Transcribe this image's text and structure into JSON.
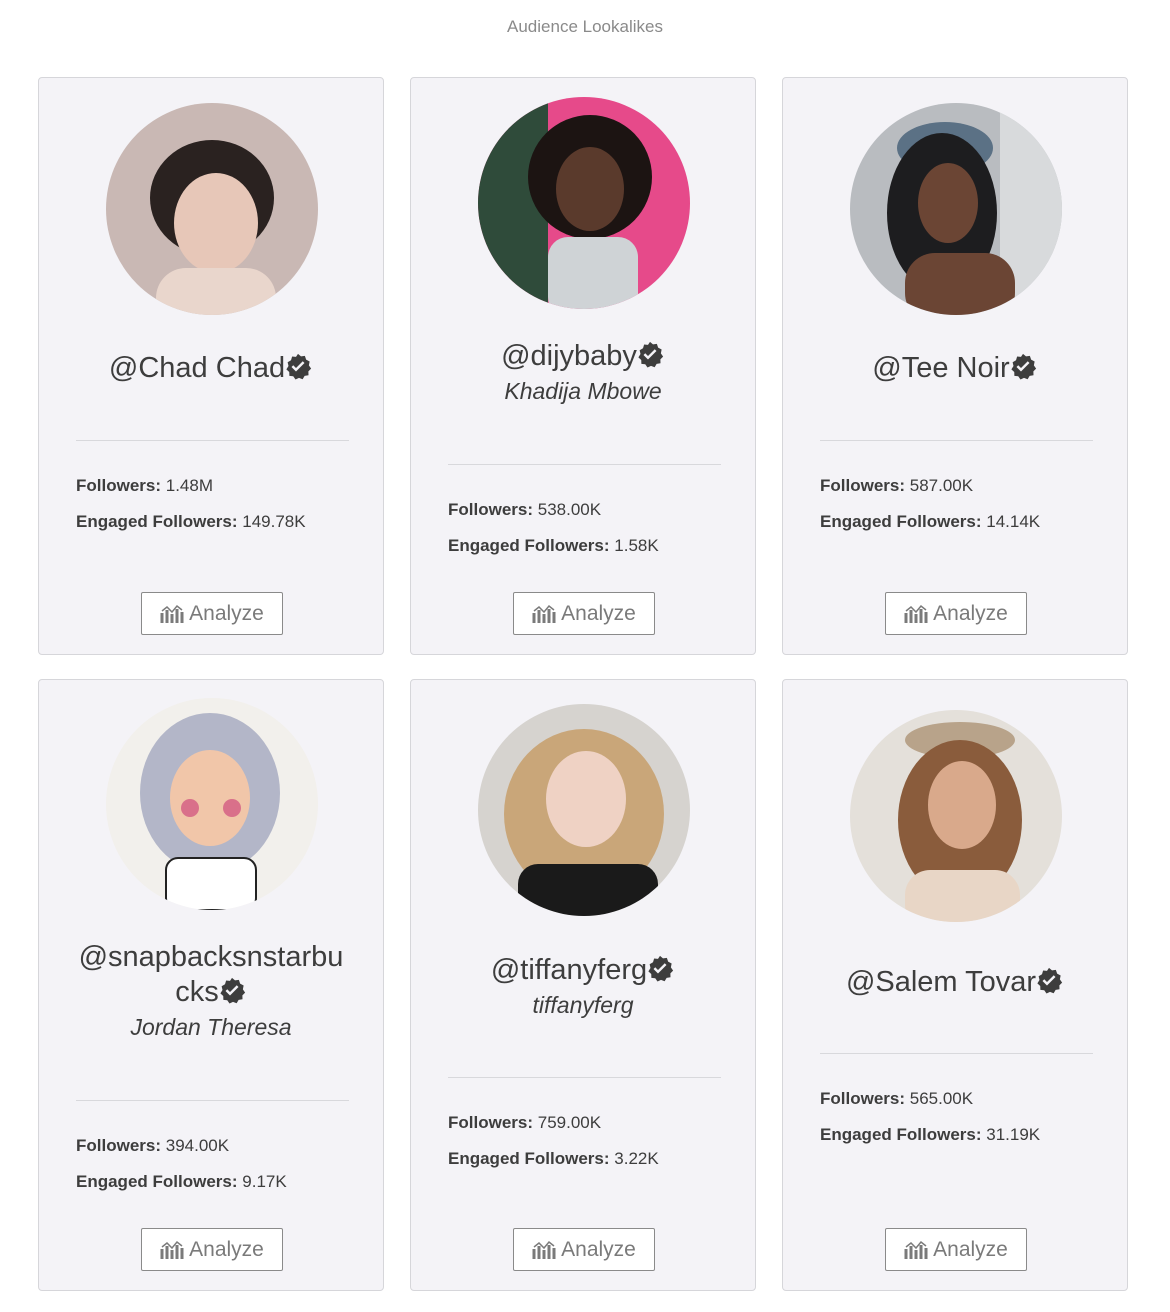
{
  "page": {
    "title": "Audience Lookalikes"
  },
  "labels": {
    "followers": "Followers:",
    "engaged": "Engaged Followers:",
    "analyze": "Analyze"
  },
  "cards": [
    {
      "handle": "@Chad Chad",
      "fullname": "",
      "followers": "1.48M",
      "engaged": "149.78K",
      "avatar_bg": "#c9b8b4",
      "avatar_fg": "#2a2220",
      "avatar_skin": "#e7c7b8"
    },
    {
      "handle": "@dijybaby",
      "fullname": "Khadija Mbowe",
      "followers": "538.00K",
      "engaged": "1.58K",
      "avatar_bg": "#e64a8a",
      "avatar_fg": "#1c1412",
      "avatar_skin": "#5a3a2c"
    },
    {
      "handle": "@Tee Noir",
      "fullname": "",
      "followers": "587.00K",
      "engaged": "14.14K",
      "avatar_bg": "#b9bcc0",
      "avatar_fg": "#1d1d1f",
      "avatar_skin": "#6b4534"
    },
    {
      "handle": "@snapbacksnstarbucks",
      "handle_line1": "@snapbacksnstarbu",
      "handle_line2": "cks",
      "fullname": "Jordan Theresa",
      "followers": "394.00K",
      "engaged": "9.17K",
      "avatar_bg": "#f2f0ec",
      "avatar_fg": "#b3b6c8",
      "avatar_skin": "#f1c6a9"
    },
    {
      "handle": "@tiffanyferg",
      "fullname": "tiffanyferg",
      "followers": "759.00K",
      "engaged": "3.22K",
      "avatar_bg": "#d6d3cf",
      "avatar_fg": "#c9a679",
      "avatar_skin": "#efd2c4"
    },
    {
      "handle": "@Salem Tovar",
      "fullname": "",
      "followers": "565.00K",
      "engaged": "31.19K",
      "avatar_bg": "#e4e0da",
      "avatar_fg": "#8a5c3c",
      "avatar_skin": "#d9a98b"
    }
  ],
  "icons": {
    "verified": "verified-check-icon",
    "analyze": "bar-chart-icon"
  }
}
